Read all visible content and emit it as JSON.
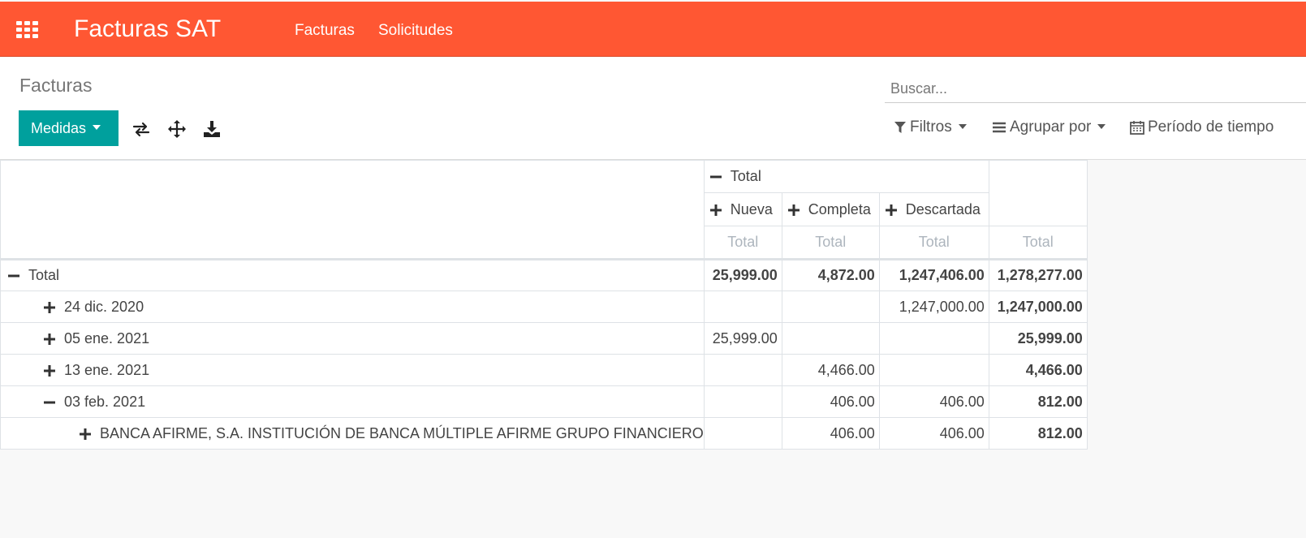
{
  "app": {
    "name": "Facturas SAT",
    "menu": [
      "Facturas",
      "Solicitudes"
    ],
    "accent_color": "#ff5733",
    "primary_button_color": "#00a09d"
  },
  "control_panel": {
    "breadcrumb": "Facturas",
    "search_placeholder": "Buscar...",
    "measures_label": "Medidas",
    "tools": [
      "flip-axis-icon",
      "expand-all-icon",
      "download-icon"
    ],
    "filters_label": "Filtros",
    "group_by_label": "Agrupar por",
    "period_label": "Período de tiempo"
  },
  "pivot": {
    "column_root": "Total",
    "columns": [
      "Nueva",
      "Completa",
      "Descartada"
    ],
    "measure_label": "Total",
    "rows": [
      {
        "label": "Total",
        "sign": "minus",
        "values": [
          "25,999.00",
          "4,872.00",
          "1,247,406.00",
          "1,278,277.00"
        ]
      },
      {
        "label": "24 dic. 2020",
        "sign": "plus",
        "values": [
          "",
          "",
          "1,247,000.00",
          "1,247,000.00"
        ]
      },
      {
        "label": "05 ene. 2021",
        "sign": "plus",
        "values": [
          "25,999.00",
          "",
          "",
          "25,999.00"
        ]
      },
      {
        "label": "13 ene. 2021",
        "sign": "plus",
        "values": [
          "",
          "4,466.00",
          "",
          "4,466.00"
        ]
      },
      {
        "label": "03 feb. 2021",
        "sign": "minus",
        "values": [
          "",
          "406.00",
          "406.00",
          "812.00"
        ]
      },
      {
        "label": "BANCA AFIRME, S.A. INSTITUCIÓN DE BANCA MÚLTIPLE AFIRME GRUPO FINANCIERO",
        "sign": "plus",
        "values": [
          "",
          "406.00",
          "406.00",
          "812.00"
        ]
      }
    ]
  }
}
